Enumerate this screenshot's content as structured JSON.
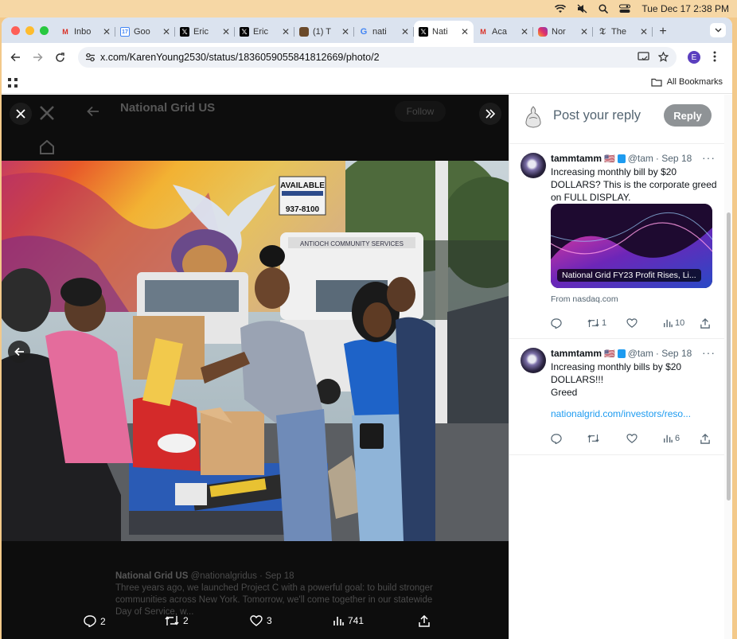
{
  "menubar": {
    "datetime": "Tue Dec 17  2:38 PM"
  },
  "browser": {
    "tabs": [
      {
        "label": "Inbo",
        "icon": "gmail-icon",
        "active": false
      },
      {
        "label": "Goo",
        "icon": "google-calendar-icon",
        "active": false
      },
      {
        "label": "Eric",
        "icon": "x-logo-icon",
        "active": false
      },
      {
        "label": "Eric",
        "icon": "x-logo-icon",
        "active": false
      },
      {
        "label": "(1) T",
        "icon": "site-favicon",
        "active": false
      },
      {
        "label": "nati",
        "icon": "google-icon",
        "active": false
      },
      {
        "label": "Nati",
        "icon": "x-logo-icon",
        "active": true
      },
      {
        "label": "Aca",
        "icon": "gmail-icon",
        "active": false
      },
      {
        "label": "Nor",
        "icon": "instagram-icon",
        "active": false
      },
      {
        "label": "The",
        "icon": "nyt-icon",
        "active": false
      }
    ],
    "url": "x.com/KarenYoung2530/status/1836059055841812669/photo/2",
    "profile_initial": "E",
    "all_bookmarks_label": "All Bookmarks"
  },
  "viewer": {
    "background_account_name": "National Grid US",
    "background_follow_label": "Follow",
    "background_post_header": "National Grid US",
    "background_post_handle": "@nationalgridus · Sep 18",
    "background_post_text": "Three years ago, we launched Project C with a powerful goal: to build stronger communities across New York. Tomorrow, we'll come together in our statewide Day of Service, w...",
    "photo_sign_available": "AVAILABLE",
    "photo_sign_phone": "937-8100",
    "photo_truck_text": "ANTIOCH COMMUNITY SERVICES",
    "actions": {
      "replies": "2",
      "reposts": "2",
      "likes": "3",
      "views": "741"
    }
  },
  "reply_box": {
    "placeholder": "Post your reply",
    "button_label": "Reply"
  },
  "tweets": [
    {
      "name": "tammtamm",
      "handle": "@tam",
      "date": "· Sep 18",
      "text": "Increasing monthly bill by $20 DOLLARS? This is the corporate greed on FULL DISPLAY.",
      "card_caption": "National Grid FY23 Profit Rises, Li...",
      "card_source": "From nasdaq.com",
      "replies": "",
      "reposts": "1",
      "likes": "",
      "views": "10"
    },
    {
      "name": "tammtamm",
      "handle": "@tam",
      "date": "· Sep 18",
      "text_line1": "Increasing monthly bills by $20 DOLLARS!!!",
      "text_line2": "Greed",
      "link": "nationalgrid.com/investors/reso...",
      "replies": "",
      "reposts": "",
      "likes": "",
      "views": "6"
    }
  ],
  "colors": {
    "desktop": "#f3c98a",
    "x_blue": "#1d9bf0",
    "reply_button": "#8f9396",
    "viewer_bg": "#0d0d0d"
  }
}
